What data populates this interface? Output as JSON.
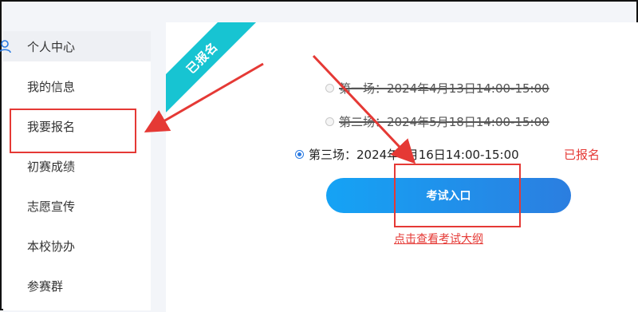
{
  "sidebar": {
    "items": [
      {
        "label": "个人中心"
      },
      {
        "label": "我的信息"
      },
      {
        "label": "我要报名"
      },
      {
        "label": "初赛成绩"
      },
      {
        "label": "志愿宣传"
      },
      {
        "label": "本校协办"
      },
      {
        "label": "参赛群"
      }
    ]
  },
  "ribbon": {
    "label": "已报名"
  },
  "sessions": [
    {
      "label": "第一场：2024年4月13日14:00-15:00",
      "selected": false
    },
    {
      "label": "第二场：2024年5月18日14:00-15:00",
      "selected": false
    },
    {
      "label": "第三场：2024年6月16日14:00-15:00",
      "selected": true
    }
  ],
  "status": {
    "registered": "已报名"
  },
  "exam_button": {
    "label": "考试入口"
  },
  "syllabus_link": {
    "label": "点击查看考试大纲"
  },
  "colors": {
    "accent_blue": "#2b7ee0",
    "ribbon": "#17c4d2",
    "annotation_red": "#e53935"
  }
}
